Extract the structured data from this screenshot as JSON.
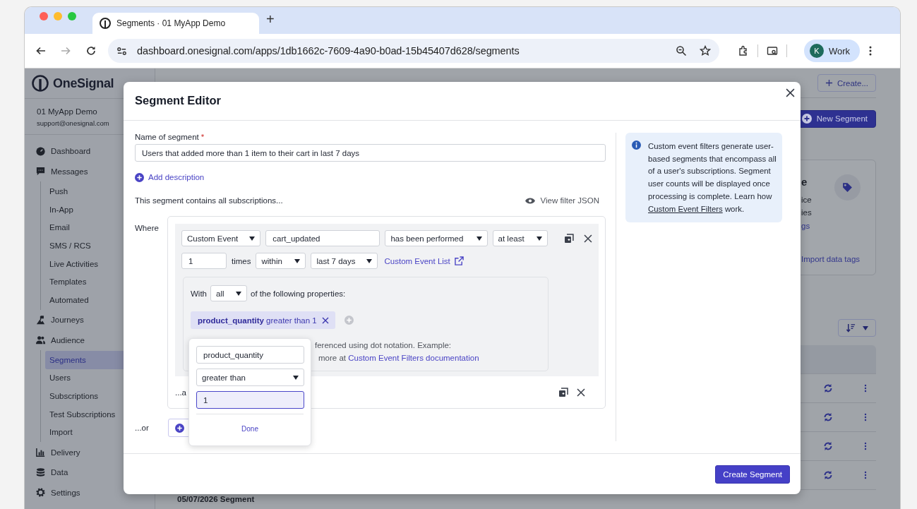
{
  "browser": {
    "tab": {
      "title": "Segments · 01 MyApp Demo",
      "new_tab": "+"
    },
    "url": "dashboard.onesignal.com/apps/1db1662c-7609-4a90-b0ad-15b45407d628/segments",
    "profile": {
      "initial": "K",
      "name": "Work"
    }
  },
  "sidebar": {
    "brand": "OneSignal",
    "app_name": "01 MyApp Demo",
    "account_email": "support@onesignal.com",
    "items": [
      {
        "label": "Dashboard",
        "selected": false
      },
      {
        "label": "Messages",
        "selected": false,
        "children": [
          {
            "label": "Push",
            "selected": false
          },
          {
            "label": "In-App",
            "selected": false
          },
          {
            "label": "Email",
            "selected": false
          },
          {
            "label": "SMS / RCS",
            "selected": false
          },
          {
            "label": "Live Activities",
            "selected": false
          },
          {
            "label": "Templates",
            "selected": false
          },
          {
            "label": "Automated",
            "selected": false
          }
        ]
      },
      {
        "label": "Journeys",
        "selected": false
      },
      {
        "label": "Audience",
        "selected": false,
        "children": [
          {
            "label": "Segments",
            "selected": true
          },
          {
            "label": "Users",
            "selected": false
          },
          {
            "label": "Subscriptions",
            "selected": false
          },
          {
            "label": "Test Subscriptions",
            "selected": false
          },
          {
            "label": "Import",
            "selected": false
          }
        ]
      },
      {
        "label": "Delivery",
        "selected": false
      },
      {
        "label": "Data",
        "selected": false
      },
      {
        "label": "Settings",
        "selected": false
      }
    ]
  },
  "page": {
    "create_button": "Create...",
    "new_segment_button": "New Segment",
    "card": {
      "fragments": [
        "e",
        "ice",
        "ies"
      ],
      "link_fragment": "gs",
      "import_link": "Import data tags"
    },
    "table": {
      "rows": [
        {
          "kind": "actions"
        },
        {
          "kind": "actions"
        },
        {
          "kind": "actions"
        },
        {
          "kind": "actions"
        },
        {
          "kind": "name",
          "name": "05/07/2026 Segment"
        }
      ]
    }
  },
  "segment_editor": {
    "title": "Segment Editor",
    "name_label": "Name of segment",
    "required_mark": "*",
    "name_value": "Users that added more than 1 item to their cart in last 7 days",
    "add_description": "Add description",
    "contains_text": "This segment contains all subscriptions...",
    "view_json": "View filter JSON",
    "where_label": "Where",
    "filter": {
      "type": "Custom Event",
      "event_name": "cart_updated",
      "performed": "has been performed",
      "comparison": "at least",
      "count": "1",
      "times_label": "times",
      "window_mode": "within",
      "window": "last 7 days",
      "event_list_link": "Custom Event List",
      "with_label": "With",
      "match": "all",
      "properties_label": "of the following properties:",
      "property_chip": {
        "key": "product_quantity",
        "condition": "greater than 1"
      },
      "help_line_1": "ferenced using dot notation. Example:",
      "help_line_2": "more at",
      "help_link": "Custom Event Filters documentation"
    },
    "and_label": "...a",
    "or_label": "...or",
    "info": {
      "text": "Custom event filters generate user-based segments that encompass all of a user's subscriptions. Segment user counts will be displayed once processing is complete. Learn how",
      "link": "Custom Event Filters",
      "suffix": "work."
    },
    "create_button": "Create Segment",
    "popover": {
      "property": "product_quantity",
      "operator": "greater than",
      "value": "1",
      "done": "Done"
    }
  }
}
